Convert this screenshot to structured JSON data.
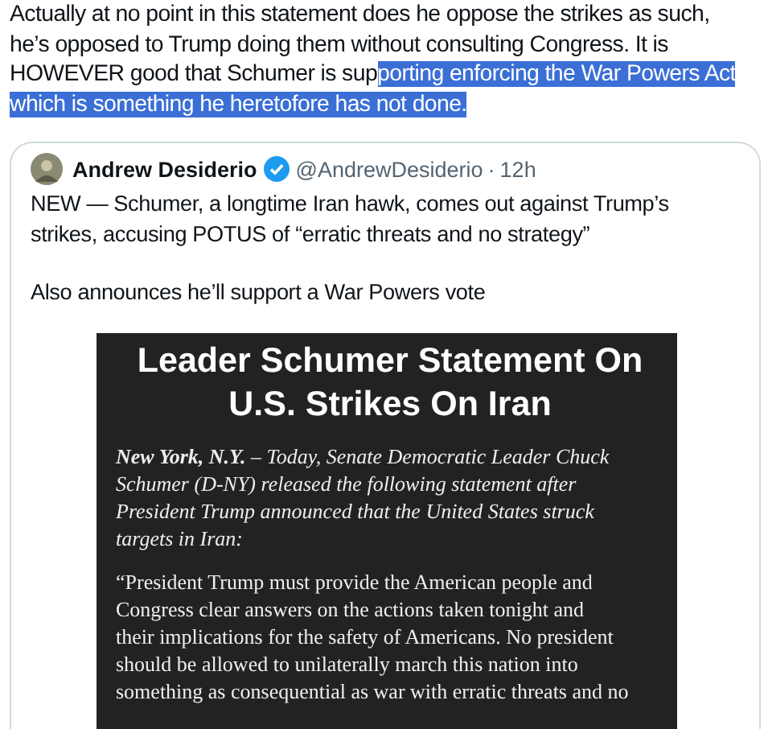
{
  "post": {
    "text_segments": [
      {
        "text": "Actually at no point in this statement does he oppose the strikes as such,\nhe’s opposed to Trump doing them without consulting Congress. It is\nHOWEVER good that Schumer is sup",
        "selected": false
      },
      {
        "text": "porting enforcing the War Powers Act\nwhich is something he heretofore has not done.",
        "selected": true
      }
    ]
  },
  "quoted_post": {
    "author_name": "Andrew Desiderio",
    "verified": true,
    "handle": "@AndrewDesiderio",
    "separator": "·",
    "time": "12h",
    "paragraphs": [
      "NEW — Schumer, a longtime Iran hawk, comes out against Trump’s\nstrikes, accusing POTUS of “erratic threats and no strategy”",
      "Also announces he’ll support a War Powers vote"
    ],
    "image": {
      "title": "Leader Schumer Statement On\nU.S. Strikes On Iran",
      "paragraphs": [
        {
          "kind": "italic",
          "text": "**New York, N.Y.** – Today, Senate Democratic Leader Chuck\nSchumer (D-NY) released the following statement after\nPresident Trump announced that the United States struck\ntargets in Iran:"
        },
        {
          "kind": "plain",
          "text": "“President Trump must provide the American people and\nCongress clear answers on the actions taken tonight and\ntheir implications for the safety of Americans. No president\nshould be allowed to unilaterally march this nation into\nsomething as consequential as war with erratic threats and no"
        }
      ]
    }
  }
}
